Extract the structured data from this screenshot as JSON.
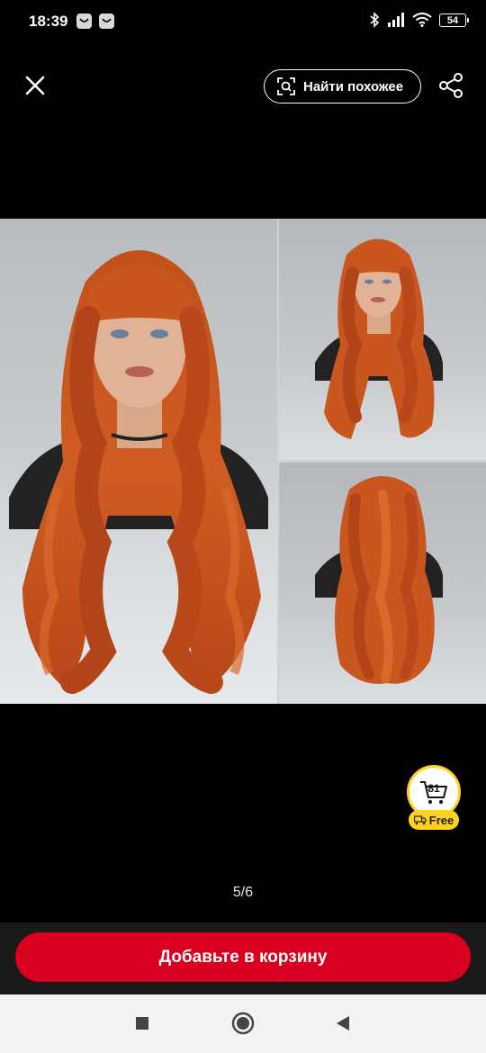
{
  "status_bar": {
    "time": "18:39",
    "battery": "54",
    "icons": [
      "notification-icon",
      "notification-icon",
      "bluetooth-icon",
      "signal-icon",
      "wifi-icon",
      "battery-icon"
    ]
  },
  "top_bar": {
    "close_icon": "close-icon",
    "find_similar_label": "Найти похожее",
    "find_similar_icon": "lens-scan-icon",
    "share_icon": "share-icon"
  },
  "gallery": {
    "counter": "5/6",
    "panels": [
      "wig-front-view",
      "wig-front-angle-view",
      "wig-back-view"
    ]
  },
  "cart_badge": {
    "count": "81",
    "free_label": "Free",
    "accent": "#ffd21f"
  },
  "actions": {
    "add_to_cart_label": "Добавьте в корзину",
    "button_color": "#d8001e"
  },
  "nav_bar": {
    "icons": [
      "recents-square-icon",
      "home-circle-icon",
      "back-triangle-icon"
    ]
  }
}
